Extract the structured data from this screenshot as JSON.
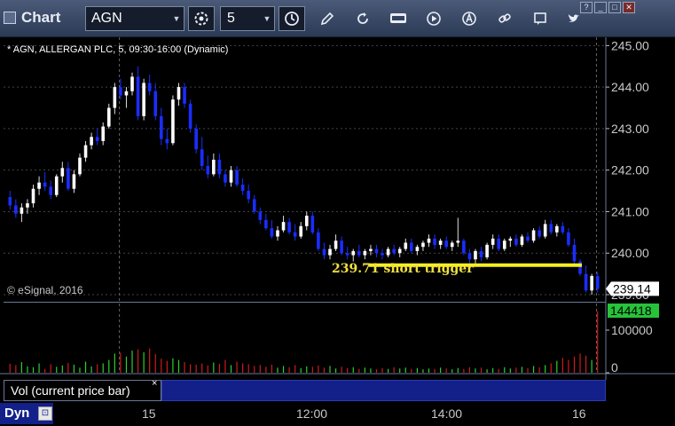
{
  "toolbar": {
    "app_title": "Chart",
    "symbol": "AGN",
    "interval": "5",
    "window_buttons": [
      "?",
      "_",
      "□",
      "✕"
    ]
  },
  "chart": {
    "title": "* AGN, ALLERGAN PLC, 5, 09:30-16:00 (Dynamic)",
    "copyright": "© eSignal, 2016",
    "annotation": "239.71 short trigger",
    "price_tag": "239.14",
    "volume_tag": "144418"
  },
  "study": {
    "label": "Vol (current price bar)",
    "close_glyph": "×"
  },
  "bottom": {
    "dyn_label": "Dyn",
    "lock_glyph": "🔒",
    "x_ticks": [
      "15",
      "12:00",
      "14:00",
      "16"
    ]
  },
  "chart_data": {
    "type": "candlestick",
    "price_axis": {
      "ticks": [
        "245.00",
        "244.00",
        "243.00",
        "242.00",
        "241.00",
        "240.00",
        "239.00"
      ],
      "range": [
        238.85,
        245.2
      ]
    },
    "volume_axis": {
      "ticks": [
        "100000",
        "0"
      ],
      "range": [
        0,
        150000
      ]
    },
    "trigger_level": 239.71,
    "last_price": 239.14,
    "last_volume": 144418,
    "colors": {
      "up": "#ffffff",
      "down": "#1a2dff",
      "trigger": "#f5f020",
      "price_tag_bg": "#ffffff",
      "volume_tag_bg": "#27c33a",
      "vol_up": "#2bd12b",
      "vol_down": "#d11a1a"
    },
    "candles": [
      [
        241.35,
        241.5,
        241.05,
        241.15
      ],
      [
        241.15,
        241.3,
        240.85,
        240.95
      ],
      [
        240.95,
        241.2,
        240.75,
        241.1
      ],
      [
        241.1,
        241.3,
        240.95,
        241.2
      ],
      [
        241.2,
        241.65,
        241.1,
        241.55
      ],
      [
        241.55,
        241.85,
        241.4,
        241.7
      ],
      [
        241.7,
        241.95,
        241.5,
        241.6
      ],
      [
        241.6,
        241.75,
        241.3,
        241.4
      ],
      [
        241.4,
        241.9,
        241.35,
        241.85
      ],
      [
        241.85,
        242.2,
        241.7,
        242.05
      ],
      [
        242.05,
        242.2,
        241.5,
        241.55
      ],
      [
        241.55,
        242.0,
        241.45,
        241.9
      ],
      [
        241.9,
        242.4,
        241.85,
        242.3
      ],
      [
        242.3,
        242.7,
        242.2,
        242.6
      ],
      [
        242.6,
        242.9,
        242.5,
        242.8
      ],
      [
        242.8,
        243.0,
        242.6,
        242.7
      ],
      [
        242.7,
        243.15,
        242.6,
        243.05
      ],
      [
        243.05,
        243.6,
        243.0,
        243.5
      ],
      [
        243.5,
        244.1,
        243.35,
        244.0
      ],
      [
        244.0,
        244.2,
        243.7,
        243.8
      ],
      [
        243.8,
        244.0,
        243.5,
        243.9
      ],
      [
        243.9,
        244.35,
        243.8,
        244.25
      ],
      [
        244.25,
        244.5,
        243.2,
        243.3
      ],
      [
        243.3,
        244.2,
        243.2,
        244.1
      ],
      [
        244.1,
        244.3,
        243.8,
        243.9
      ],
      [
        243.9,
        244.1,
        243.2,
        243.3
      ],
      [
        243.3,
        243.5,
        242.6,
        242.75
      ],
      [
        242.75,
        243.0,
        242.5,
        242.65
      ],
      [
        242.65,
        243.8,
        242.6,
        243.7
      ],
      [
        243.7,
        244.1,
        243.55,
        244.0
      ],
      [
        244.0,
        244.1,
        243.5,
        243.6
      ],
      [
        243.6,
        243.7,
        242.9,
        243.0
      ],
      [
        243.0,
        243.1,
        242.4,
        242.5
      ],
      [
        242.5,
        242.8,
        242.0,
        242.1
      ],
      [
        242.1,
        242.35,
        241.8,
        241.9
      ],
      [
        241.9,
        242.4,
        241.85,
        242.25
      ],
      [
        242.25,
        242.4,
        241.8,
        241.9
      ],
      [
        241.9,
        242.0,
        241.6,
        241.7
      ],
      [
        241.7,
        242.1,
        241.6,
        242.0
      ],
      [
        242.0,
        242.1,
        241.6,
        241.65
      ],
      [
        241.65,
        241.8,
        241.4,
        241.5
      ],
      [
        241.5,
        241.65,
        241.2,
        241.3
      ],
      [
        241.3,
        241.4,
        240.95,
        241.0
      ],
      [
        241.0,
        241.1,
        240.7,
        240.8
      ],
      [
        240.8,
        240.95,
        240.55,
        240.6
      ],
      [
        240.6,
        240.8,
        240.35,
        240.4
      ],
      [
        240.4,
        240.65,
        240.3,
        240.55
      ],
      [
        240.55,
        240.9,
        240.5,
        240.75
      ],
      [
        240.75,
        240.85,
        240.45,
        240.5
      ],
      [
        240.5,
        240.7,
        240.3,
        240.4
      ],
      [
        240.4,
        240.75,
        240.35,
        240.65
      ],
      [
        240.65,
        241.0,
        240.55,
        240.9
      ],
      [
        240.9,
        241.0,
        240.45,
        240.5
      ],
      [
        240.5,
        240.6,
        240.05,
        240.1
      ],
      [
        240.1,
        240.25,
        239.85,
        239.95
      ],
      [
        239.95,
        240.2,
        239.85,
        240.1
      ],
      [
        240.1,
        240.45,
        240.05,
        240.3
      ],
      [
        240.3,
        240.4,
        239.95,
        240.0
      ],
      [
        240.0,
        240.15,
        239.85,
        239.95
      ],
      [
        239.95,
        240.1,
        239.8,
        240.05
      ],
      [
        240.05,
        240.2,
        239.9,
        239.95
      ],
      [
        239.95,
        240.1,
        239.85,
        240.05
      ],
      [
        240.05,
        240.2,
        239.95,
        240.1
      ],
      [
        240.1,
        240.2,
        239.9,
        240.0
      ],
      [
        240.0,
        240.1,
        239.85,
        239.95
      ],
      [
        239.95,
        240.15,
        239.9,
        240.1
      ],
      [
        240.1,
        240.2,
        239.95,
        240.0
      ],
      [
        240.0,
        240.15,
        239.9,
        240.1
      ],
      [
        240.1,
        240.35,
        240.05,
        240.25
      ],
      [
        240.25,
        240.35,
        240.0,
        240.05
      ],
      [
        240.05,
        240.2,
        239.95,
        240.15
      ],
      [
        240.15,
        240.3,
        240.05,
        240.25
      ],
      [
        240.25,
        240.45,
        240.15,
        240.35
      ],
      [
        240.35,
        240.45,
        240.1,
        240.2
      ],
      [
        240.2,
        240.35,
        240.1,
        240.3
      ],
      [
        240.3,
        240.4,
        240.1,
        240.15
      ],
      [
        240.15,
        240.3,
        240.05,
        240.25
      ],
      [
        240.25,
        240.85,
        240.15,
        240.3
      ],
      [
        240.3,
        240.35,
        239.95,
        240.0
      ],
      [
        240.0,
        240.1,
        239.75,
        239.85
      ],
      [
        239.85,
        240.1,
        239.75,
        240.05
      ],
      [
        240.05,
        240.15,
        239.8,
        239.9
      ],
      [
        239.9,
        240.25,
        239.85,
        240.2
      ],
      [
        240.2,
        240.45,
        240.1,
        240.35
      ],
      [
        240.35,
        240.45,
        240.05,
        240.1
      ],
      [
        240.1,
        240.35,
        240.05,
        240.3
      ],
      [
        240.3,
        240.4,
        240.15,
        240.35
      ],
      [
        240.35,
        240.45,
        240.15,
        240.2
      ],
      [
        240.2,
        240.45,
        240.15,
        240.4
      ],
      [
        240.4,
        240.5,
        240.25,
        240.3
      ],
      [
        240.3,
        240.6,
        240.25,
        240.55
      ],
      [
        240.55,
        240.65,
        240.35,
        240.4
      ],
      [
        240.4,
        240.8,
        240.35,
        240.7
      ],
      [
        240.7,
        240.8,
        240.45,
        240.5
      ],
      [
        240.5,
        240.7,
        240.4,
        240.65
      ],
      [
        240.65,
        240.75,
        240.45,
        240.5
      ],
      [
        240.5,
        240.6,
        240.15,
        240.2
      ],
      [
        240.2,
        240.35,
        239.75,
        239.8
      ],
      [
        239.8,
        239.85,
        239.45,
        239.5
      ],
      [
        239.5,
        239.7,
        239.05,
        239.1
      ],
      [
        239.1,
        239.5,
        239.0,
        239.45
      ],
      [
        239.45,
        239.55,
        239.05,
        239.14
      ]
    ],
    "volumes": [
      21000,
      18000,
      25000,
      15000,
      13000,
      22000,
      9000,
      20000,
      14000,
      17000,
      23000,
      19000,
      12000,
      26000,
      15000,
      20000,
      22000,
      30000,
      45000,
      47000,
      38000,
      52000,
      55000,
      48000,
      57000,
      44000,
      33000,
      28000,
      34000,
      30000,
      25000,
      20000,
      19000,
      22000,
      17000,
      24000,
      21000,
      30000,
      18000,
      26000,
      22000,
      20000,
      16000,
      18000,
      14000,
      19000,
      12000,
      16000,
      13000,
      18000,
      11000,
      15000,
      14000,
      17000,
      12000,
      16000,
      10000,
      14000,
      11000,
      13000,
      9000,
      12000,
      10000,
      8000,
      11000,
      9000,
      13000,
      10000,
      12000,
      9000,
      11000,
      8000,
      10000,
      9000,
      12000,
      10000,
      8000,
      11000,
      9000,
      13000,
      10000,
      12000,
      8000,
      11000,
      9000,
      13000,
      10000,
      12000,
      14000,
      11000,
      16000,
      13000,
      18000,
      22000,
      28000,
      35000,
      30000,
      38000,
      45000,
      40000,
      30000,
      144418
    ]
  }
}
